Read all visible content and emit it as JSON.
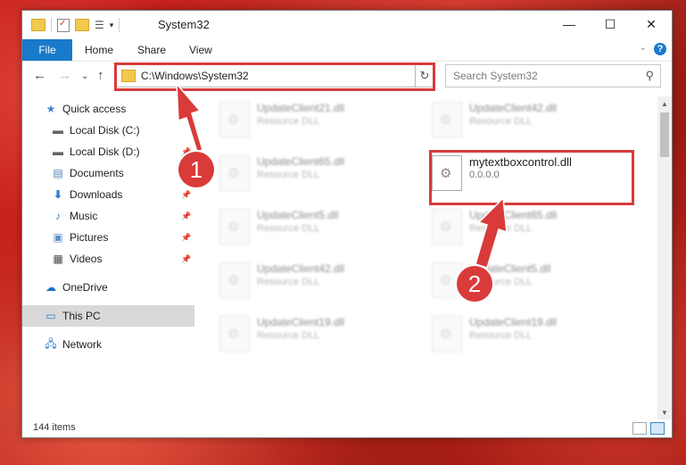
{
  "window": {
    "title": "System32"
  },
  "ribbon": {
    "file": "File",
    "home": "Home",
    "share": "Share",
    "view": "View",
    "help": "?"
  },
  "address": {
    "path": "C:\\Windows\\System32"
  },
  "search": {
    "placeholder": "Search System32"
  },
  "sidebar": {
    "items": [
      {
        "label": "Quick access",
        "icon": "star-icon",
        "pinned": false
      },
      {
        "label": "Local Disk (C:)",
        "icon": "drive-icon",
        "pinned": false
      },
      {
        "label": "Local Disk (D:)",
        "icon": "drive-icon",
        "pinned": true
      },
      {
        "label": "Documents",
        "icon": "documents-icon",
        "pinned": true
      },
      {
        "label": "Downloads",
        "icon": "downloads-icon",
        "pinned": true
      },
      {
        "label": "Music",
        "icon": "music-icon",
        "pinned": true
      },
      {
        "label": "Pictures",
        "icon": "pictures-icon",
        "pinned": true
      },
      {
        "label": "Videos",
        "icon": "videos-icon",
        "pinned": true
      },
      {
        "label": "OneDrive",
        "icon": "cloud-icon",
        "pinned": false
      },
      {
        "label": "This PC",
        "icon": "computer-icon",
        "pinned": false,
        "selected": true
      },
      {
        "label": "Network",
        "icon": "network-icon",
        "pinned": false
      }
    ]
  },
  "files": [
    {
      "name": "UpdateClient21.dll",
      "type": "Resource DLL"
    },
    {
      "name": "UpdateClient42.dll",
      "type": "Resource DLL"
    },
    {
      "name": "UpdateClient65.dll",
      "type": "Resource DLL"
    },
    {
      "name": "mytextboxcontrol.dll",
      "type": "0.0.0.0"
    },
    {
      "name": "UpdateClient5.dll",
      "type": "Resource DLL"
    },
    {
      "name": "UpdateClient65.dll",
      "type": "Resource DLL"
    },
    {
      "name": "UpdateClient42.dll",
      "type": "Resource DLL"
    },
    {
      "name": "UpdateClient5.dll",
      "type": "Resource DLL"
    },
    {
      "name": "UpdateClient19.dll",
      "type": "Resource DLL"
    },
    {
      "name": "UpdateClient19.dll",
      "type": "Resource DLL"
    }
  ],
  "status": {
    "count": "144 items"
  },
  "annotations": {
    "step1": "1",
    "step2": "2",
    "color": "#d93a3a"
  }
}
